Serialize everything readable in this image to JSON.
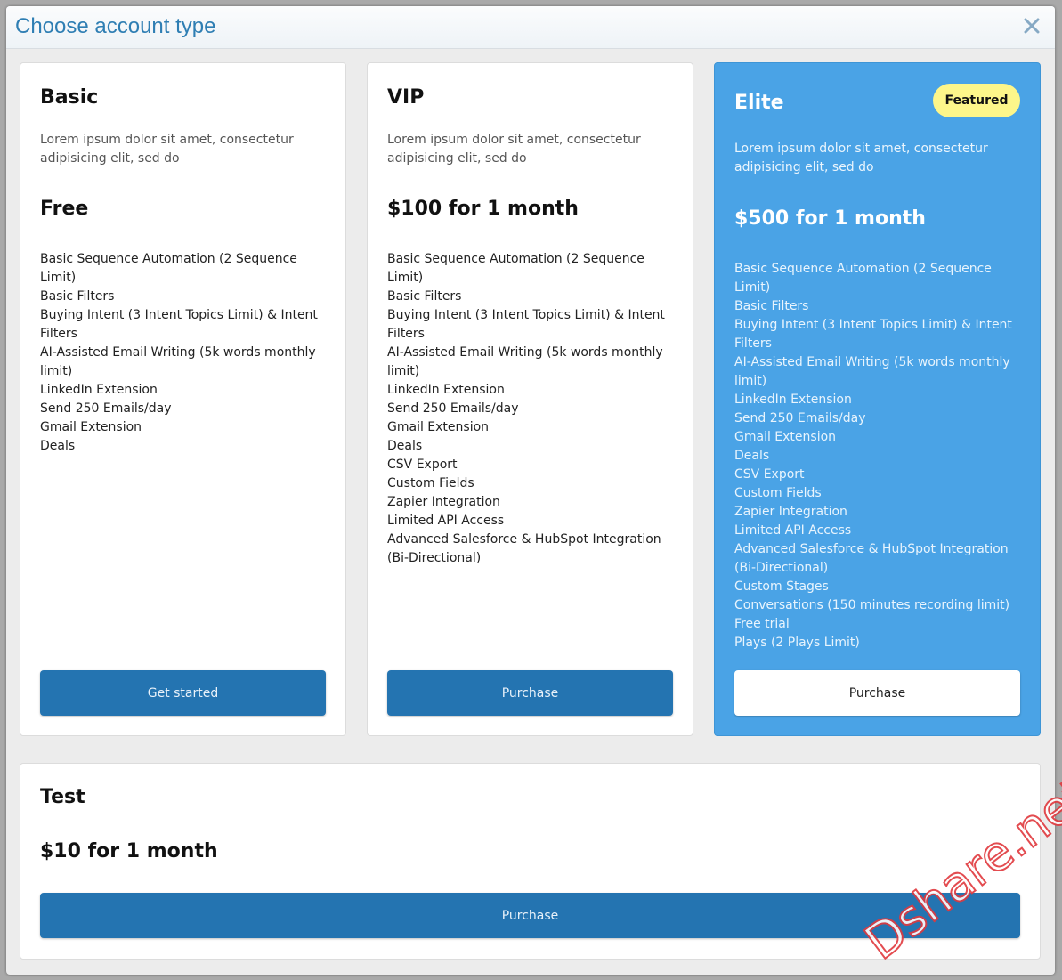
{
  "dialog": {
    "title": "Choose account type"
  },
  "cards": [
    {
      "name": "Basic",
      "description": "Lorem ipsum dolor sit amet, consectetur adipisicing elit, sed do",
      "price": "Free",
      "features": [
        "Basic Sequence Automation (2 Sequence Limit)",
        "Basic Filters",
        "Buying Intent (3 Intent Topics Limit) & Intent Filters",
        "AI-Assisted Email Writing (5k words monthly limit)",
        "LinkedIn Extension",
        "Send 250 Emails/day",
        "Gmail Extension",
        "Deals"
      ],
      "button": "Get started"
    },
    {
      "name": "VIP",
      "description": "Lorem ipsum dolor sit amet, consectetur adipisicing elit, sed do",
      "price": "$100 for 1 month",
      "features": [
        "Basic Sequence Automation (2 Sequence Limit)",
        "Basic Filters",
        "Buying Intent (3 Intent Topics Limit) & Intent Filters",
        "AI-Assisted Email Writing (5k words monthly limit)",
        "LinkedIn Extension",
        "Send 250 Emails/day",
        "Gmail Extension",
        "Deals",
        "CSV Export",
        "Custom Fields",
        "Zapier Integration",
        "Limited API Access",
        "Advanced Salesforce & HubSpot Integration (Bi-Directional)"
      ],
      "button": "Purchase"
    },
    {
      "name": "Elite",
      "badge": "Featured",
      "description": "Lorem ipsum dolor sit amet, consectetur adipisicing elit, sed do",
      "price": "$500 for 1 month",
      "features": [
        "Basic Sequence Automation (2 Sequence Limit)",
        "Basic Filters",
        "Buying Intent (3 Intent Topics Limit) & Intent Filters",
        "AI-Assisted Email Writing (5k words monthly limit)",
        "LinkedIn Extension",
        "Send 250 Emails/day",
        "Gmail Extension",
        "Deals",
        "CSV Export",
        "Custom Fields",
        "Zapier Integration",
        "Limited API Access",
        "Advanced Salesforce & HubSpot Integration (Bi-Directional)",
        "Custom Stages",
        "Conversations (150 minutes recording limit)",
        "Free trial",
        "Plays (2 Plays Limit)"
      ],
      "button": "Purchase"
    },
    {
      "name": "Test",
      "price": "$10 for 1 month",
      "button": "Purchase"
    }
  ],
  "watermark": "Dshare.net",
  "colors": {
    "accent": "#2474b1",
    "featured": "#4aa3e6",
    "badge": "#fdf68a",
    "title": "#2e7eb3"
  }
}
